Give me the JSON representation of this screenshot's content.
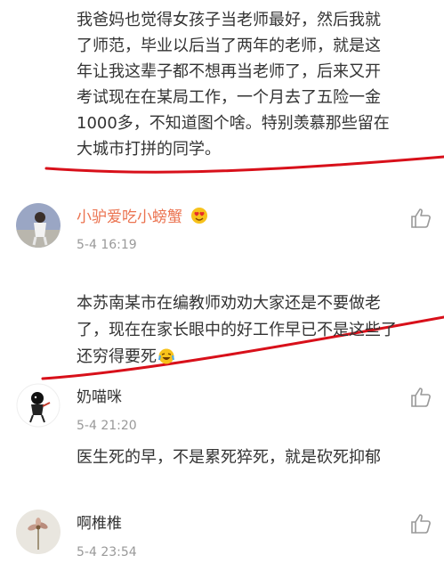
{
  "top_comment": {
    "text": "我爸妈也觉得女孩子当老师最好，然后我就\n了师范，毕业以后当了两年的老师，就是这\n年让我这辈子都不想再当老师了，后来又开\n考试现在在某局工作，一个月去了五险一金\n1000多，不知道图个啥。特别羡慕那些留在\n大城市打拼的同学。"
  },
  "comments": [
    {
      "username": "小驴爱吃小螃蟹",
      "badge_icon": "heart-eyes-emoji-icon",
      "time": "5-4 16:19",
      "text": "本苏南某市在编教师劝劝大家还是不要做老\n了，现在在家长眼中的好工作早已不是这些了\n还穷得要死",
      "inline_emoji": "laugh-cry-emoji-icon",
      "like_icon": "thumbs-up-icon"
    },
    {
      "username": "奶喵咪",
      "time": "5-4 21:20",
      "text": "医生死的早，不是累死猝死，就是砍死抑郁",
      "like_icon": "thumbs-up-icon"
    },
    {
      "username": "啊椎椎",
      "time": "5-4 23:54",
      "like_icon": "thumbs-up-icon"
    }
  ],
  "colors": {
    "annotation_line": "#d8101a",
    "username_highlight": "#eb7350",
    "timestamp": "#999999"
  }
}
